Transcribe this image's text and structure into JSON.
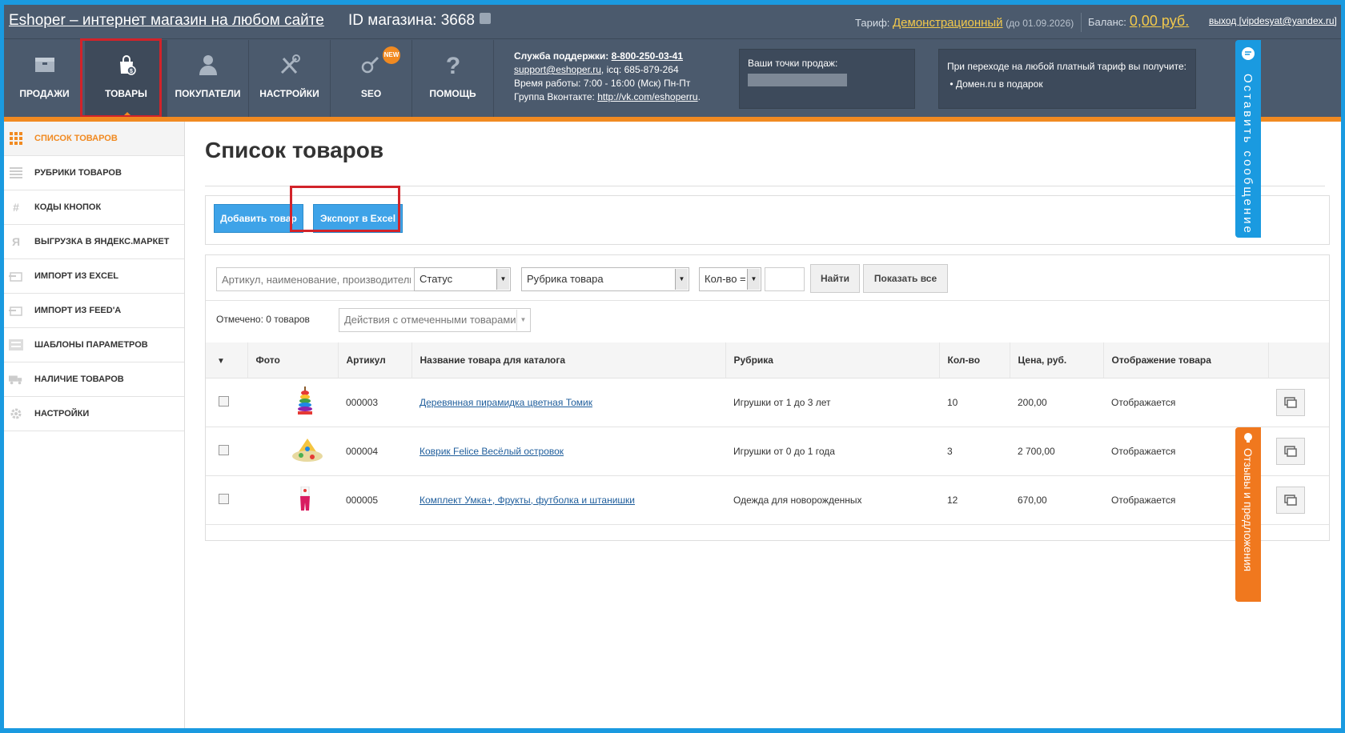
{
  "header": {
    "site_title": "Eshoper – интернет магазин на любом сайте",
    "shop_id": "ID магазина: 3668",
    "tariff_label": "Тариф:",
    "tariff_name": "Демонстрационный",
    "tariff_until": "(до 01.09.2026)",
    "balance_label": "Баланс:",
    "balance_value": "0,00 руб.",
    "logout": "выход [vipdesyat@yandex.ru]"
  },
  "nav": {
    "items": [
      {
        "label": "ПРОДАЖИ",
        "icon": "box-icon"
      },
      {
        "label": "ТОВАРЫ",
        "icon": "shopping-bag-icon",
        "active": true
      },
      {
        "label": "ПОКУПАТЕЛИ",
        "icon": "user-icon"
      },
      {
        "label": "НАСТРОЙКИ",
        "icon": "tools-icon"
      },
      {
        "label": "SEO",
        "icon": "seo-icon",
        "badge": "NEW"
      },
      {
        "label": "ПОМОЩЬ",
        "icon": "question-icon"
      }
    ]
  },
  "support": {
    "title": "Служба поддержки:",
    "phone": "8-800-250-03-41",
    "email": "support@eshoper.ru",
    "icq": ", icq: 685-879-264",
    "hours": "Время работы: 7:00 - 16:00 (Мск) Пн-Пт",
    "vk_label": "Группа Вконтакте:",
    "vk_url": "http://vk.com/eshoperru",
    "vk_dot": "."
  },
  "points": {
    "title": "Ваши точки продаж:"
  },
  "promo": {
    "title": "При переходе на любой платный тариф вы получите:",
    "item": "Домен.ru в подарок"
  },
  "sidebar": {
    "items": [
      {
        "label": "СПИСОК ТОВАРОВ",
        "icon": "grid-icon",
        "active": true
      },
      {
        "label": "РУБРИКИ ТОВАРОВ",
        "icon": "list-icon"
      },
      {
        "label": "КОДЫ КНОПОК",
        "icon": "hash-icon"
      },
      {
        "label": "ВЫГРУЗКА В ЯНДЕКС.МАРКЕТ",
        "icon": "yandex-icon"
      },
      {
        "label": "ИМПОРТ ИЗ EXCEL",
        "icon": "import-icon"
      },
      {
        "label": "ИМПОРТ ИЗ FEED'А",
        "icon": "feed-icon"
      },
      {
        "label": "ШАБЛОНЫ ПАРАМЕТРОВ",
        "icon": "template-icon"
      },
      {
        "label": "НАЛИЧИЕ ТОВАРОВ",
        "icon": "truck-icon"
      },
      {
        "label": "НАСТРОЙКИ",
        "icon": "gear-icon"
      }
    ]
  },
  "main": {
    "title": "Список товаров",
    "add_button": "Добавить товар",
    "export_button": "Экспорт в Excel",
    "search_placeholder": "Артикул, наименование, производитель",
    "status_select": "Статус",
    "category_select": "Рубрика товара",
    "qty_select": "Кол-во =",
    "find_button": "Найти",
    "show_all_button": "Показать все",
    "marked": "Отмечено: 0 товаров",
    "actions_select": "Действия с отмеченными товарами",
    "columns": [
      "Фото",
      "Артикул",
      "Название товара для каталога",
      "Рубрика",
      "Кол-во",
      "Цена, руб.",
      "Отображение товара"
    ],
    "rows": [
      {
        "sku": "000003",
        "name": "Деревянная пирамидка цветная Томик",
        "category": "Игрушки от 1 до 3 лет",
        "qty": "10",
        "price": "200,00",
        "display": "Отображается"
      },
      {
        "sku": "000004",
        "name": "Коврик Felice Весёлый островок",
        "category": "Игрушки от 0 до 1 года",
        "qty": "3",
        "price": "2 700,00",
        "display": "Отображается"
      },
      {
        "sku": "000005",
        "name": "Комплект Умка+, Фрукты, футболка и штанишки",
        "category": "Одежда для новорожденных",
        "qty": "12",
        "price": "670,00",
        "display": "Отображается"
      }
    ]
  },
  "tabs": {
    "feedback": "Оставить сообщение",
    "reviews": "Отзывы и предложения"
  },
  "colors": {
    "accent": "#f18a21",
    "header": "#4b5a6d",
    "button": "#3ea3e8",
    "highlight": "#d2232a"
  }
}
